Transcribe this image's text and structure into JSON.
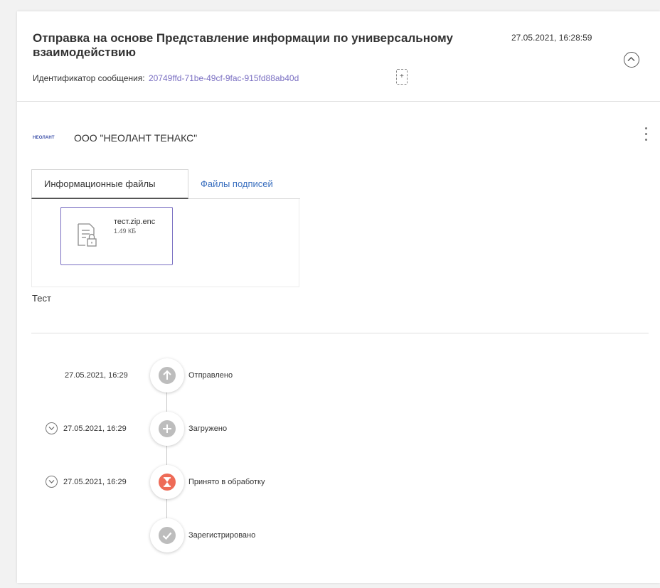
{
  "header": {
    "title": "Отправка на основе Представление информации по универсальному взаимодействию",
    "datetime": "27.05.2021, 16:28:59",
    "message_id_label": "Идентификатор сообщения:",
    "message_id_value": "20749ffd-71be-49cf-9fac-915fd88ab40d"
  },
  "organization": {
    "logo_text": "НЕОЛАНТ",
    "name": "ООО \"НЕОЛАНТ ТЕНАКС\""
  },
  "tabs": [
    {
      "label": "Информационные файлы",
      "active": true
    },
    {
      "label": "Файлы подписей",
      "active": false
    }
  ],
  "files": [
    {
      "name": "тест.zip.enc",
      "size": "1.49 КБ"
    }
  ],
  "description": "Тест",
  "timeline": [
    {
      "datetime": "27.05.2021, 16:29",
      "status": "Отправлено",
      "icon": "arrow-up-icon",
      "color": "#bdbdbd",
      "expandable": false
    },
    {
      "datetime": "27.05.2021, 16:29",
      "status": "Загружено",
      "icon": "plus-icon",
      "color": "#bdbdbd",
      "expandable": true
    },
    {
      "datetime": "27.05.2021, 16:29",
      "status": "Принято в обработку",
      "icon": "hourglass-icon",
      "color": "#ee6b57",
      "expandable": true
    },
    {
      "datetime": "",
      "status": "Зарегистрировано",
      "icon": "check-icon",
      "color": "#bdbdbd",
      "expandable": false
    }
  ],
  "colors": {
    "link": "#7a6fc2",
    "tab_link": "#3a6fbf",
    "processing": "#ee6b57",
    "neutral_status": "#bdbdbd"
  }
}
